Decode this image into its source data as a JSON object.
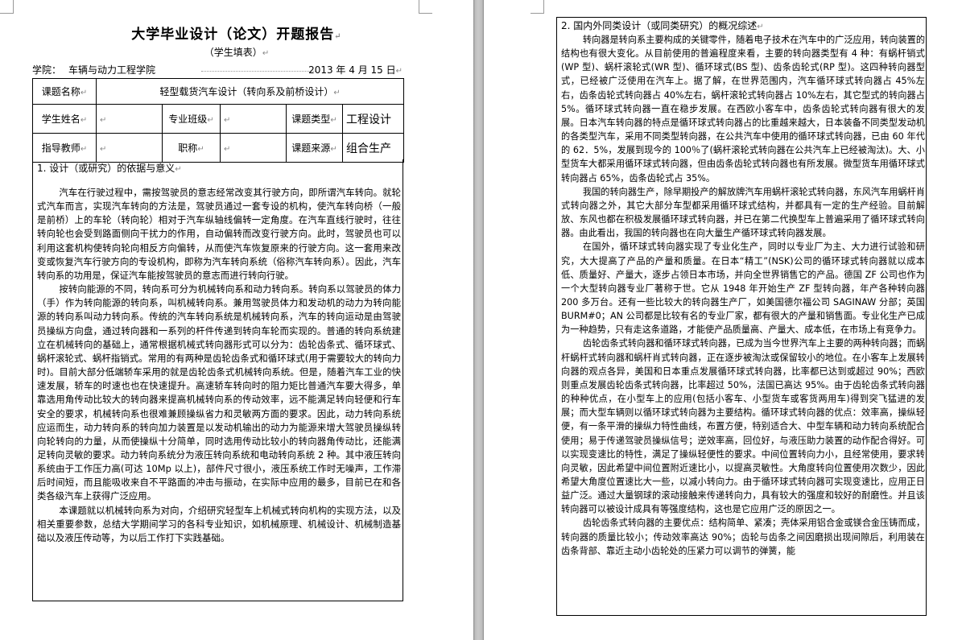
{
  "left_page": {
    "title": "大学毕业设计（论文）开题报告",
    "subtitle": "（学生填表）",
    "school_label": "学院：",
    "school_name": "车辆与动力工程学院",
    "date": "2013 年 4 月 15 日",
    "table": {
      "topic_label": "课题名称",
      "topic_value": "轻型载货汽车设计（转向系及前桥设计）",
      "student_label": "学生姓名",
      "student_value": "",
      "major_label": "专业班级",
      "major_value": "",
      "type_label": "课题类型",
      "type_value": "工程设计",
      "teacher_label": "指导教师",
      "teacher_value": "",
      "title_label": "职称",
      "title_value": "",
      "source_label": "课题来源",
      "source_value": "组合生产"
    },
    "basis": {
      "heading": "1. 设计（或研究）的依据与意义",
      "paragraphs": [
        "汽车在行驶过程中，需按驾驶员的意志经常改变其行驶方向，即所谓汽车转向。就轮式汽车而言，实现汽车转向的方法是，驾驶员通过一套专设的机构，使汽车转向桥（一般是前桥）上的车轮（转向轮）相对于汽车纵轴线偏转一定角度。在汽车直线行驶时，往往转向轮也会受到路面侧向干扰力的作用，自动偏转而改变行驶方向。此时，驾驶员也可以利用这套机构使转向轮向相反方向偏转，从而使汽车恢复原来的行驶方向。这一套用来改变或恢复汽车行驶方向的专设机构，即称为汽车转向系统（俗称汽车转向系）。因此，汽车转向系的功用是，保证汽车能按驾驶员的意志而进行转向行驶。",
        "按转向能源的不同，转向系可分为机械转向系和动力转向系。转向系以驾驶员的体力（手）作为转向能源的转向系，叫机械转向系。兼用驾驶员体力和发动机的动力为转向能源的转向系叫动力转向系。传统的汽车转向系统是机械转向系，汽车的转向运动是由驾驶员操纵方向盘，通过转向器和一系列的杆件传递到转向车轮而实现的。普通的转向系统建立在机械转向的基础上，通常根据机械式转向器形式可以分为：齿轮齿条式、循环球式、蜗杆滚轮式、蜗杆指销式。常用的有两种是齿轮齿条式和循环球式(用于需要较大的转向力时)。目前大部分低端轿车采用的就是齿轮齿条式机械转向系统。但是，随着汽车工业的快速发展，轿车的时速也也在快速提升。高速轿车转向时的阻力矩比普通汽车要大得多，单靠选用角传动比较大的转向器来提高机械转向系的传动效率，远不能满足转向轻便和行车安全的要求，机械转向系也很难兼顾操纵省力和灵敏两方面的要求。因此，动力转向系统应运而生，动力转向系的转向加力装置是以发动机输出的动力为能源来增大驾驶员操纵转向轮转向的力量，从而使操纵十分简单，同时选用传动比较小的转向器角传动比，还能满足转向灵敏的要求。动力转向系统分为液压转向系统和电动转向系统 2 种。其中液压转向系统由于工作压力高(可达 10Mp 以上)，部件尺寸很小，液压系统工作时无噪声，工作滞后时间短，而且能吸收来自不平路面的冲击与振动，在实际中应用的最多，目前已在和各类各级汽车上获得广泛应用。",
        "本课题就以机械转向系为对向，介绍研究轻型车上机械式转向机构的实现方法，以及相关重要参数，总结大学期间学习的各科专业知识，如机械原理、机械设计、机械制造基础以及液压传动等，为以后工作打下实践基础。"
      ]
    }
  },
  "right_page": {
    "heading": "2. 国内外同类设计（或同类研究）的概况综述",
    "paragraphs": [
      "转向器是转向系主要构成的关键零件，随着电子技术在汽车中的广泛应用，转向装置的结构也有很大变化。从目前使用的普遍程度来看，主要的转向器类型有 4 种：有蜗杆销式(WP 型)、蜗杆滚轮式(WR 型)、循环球式(BS 型)、齿条齿轮式(RP 型)。这四种转向器型式，已经被广泛使用在汽车上。据了解，在世界范围内，汽车循环球式转向器占 45%左右，齿条齿轮式转向器占 40%左右，蜗杆滚轮式转向器占 10%左右，其它型式的转向器占 5%。循环球式转向器一直在稳步发展。在西欧小客车中，齿条齿轮式转向器有很大的发展。日本汽车转向器的特点是循环球式转向器占的比重越来越大，日本装备不同类型发动机的各类型汽车，采用不同类型转向器，在公共汽车中使用的循环球式转向器，已由 60 年代的 62．5%，发展到现今的 100％了(蜗杆滚轮式转向器在公共汽车上已经被淘汰)。大、小型货车大都采用循环球式转向器，但由齿条齿轮式转向器也有所发展。微型货车用循环球式转向器占 65%，齿条齿轮式占 35%。",
      "我国的转向器生产，除早期投产的解放牌汽车用蜗杆滚轮式转向器，东风汽车用蜗杆肖式转向器之外，其它大部分车型都采用循环球式结构，并都具有一定的生产经验。目前解放、东风也都在积极发展循环球式转向器，并已在第二代换型车上普遍采用了循环球式转向器。由此看出，我国的转向器也在向大量生产循环球式转向器发展。",
      "在国外，循环球式转向器实现了专业化生产，同时以专业厂为主、大力进行试验和研究，大大提高了产品的产量和质量。在日本“精工”(NSK)公司的循环球式转向器就以成本低、质量好、产量大，逐步占领日本市场，并向全世界销售它的产品。德国 ZF 公司也作为一个大型转向器专业厂著称于世。它从 1948 年开始生产 ZF 型转向器，年产各种转向器 200 多万台。还有一些比较大的转向器生产厂，如美国德尔福公司 SAGINAW 分部；英国 BURM#0；AN 公司都是比较有名的专业厂家，都有很大的产量和销售面。专业化生产已成为一种趋势，只有走这条道路，才能使产品质量高、产量大、成本低，在市场上有竞争力。",
      "齿轮齿条式转向器和循环球式转向器，已成为当今世界汽车上主要的两种转向器；而蜗杆蜗杆式转向器和蜗杆肖式转向器，正在逐步被淘汰或保留较小的地位。在小客车上发展转向器的观点各异，美国和日本重点发展循环球式转向器，比率都已达到或超过 90%；西欧则重点发展齿轮齿条式转向器，比率超过 50%，法国已高达 95%。由于齿轮齿条式转向器的种种优点，在小型车上的应用(包括小客车、小型货车或客货两用车)得到突飞猛进的发展；而大型车辆则以循环球式转向器为主要结构。循环球式转向器的优点：效率高，操纵轻便，有一条平滑的操纵力特性曲线，布置方便，特别适合大、中型车辆和动力转向系统配合使用；易于传递驾驶员操纵信号；逆效率高，回位好，与液压助力装置的动作配合得好。可以实现变速比的特性，满足了操纵轻便性的要求。中间位置转向力小，且经常使用，要求转向灵敏，因此希望中间位置附近速比小，以提高灵敏性。大角度转向位置使用次数少，因此希望大角度位置速比大一些，以减小转向力。由于循环球式转向器可实现变速比，应用正日益广泛。通过大量钢球的滚动接触来传递转向力，具有较大的强度和较好的耐磨性。并且该转向器可以被设计成具有等强度结构，这也是它应用广泛的原因之一。",
      "齿轮齿条式转向器的主要优点：结构简单、紧凑；壳体采用铝合金或镁合金压铸而成，转向器的质量比较小；传动效率高达 90%；齿轮与齿条之间因磨损出现间隙后，利用装在齿条背部、靠近主动小齿轮处的压紧力可以调节的弹簧，能"
    ]
  }
}
